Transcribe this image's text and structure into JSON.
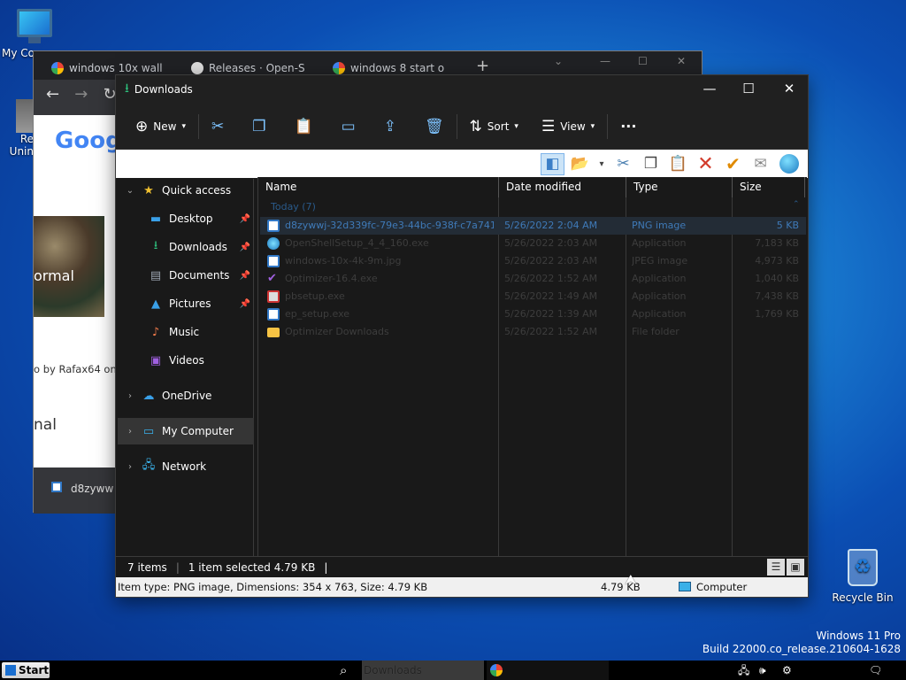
{
  "desktop": {
    "my_computer_label": "My Co",
    "recycle_bin_label": "Recycle Bin",
    "uninstall_label_1": "Re",
    "uninstall_label_2": "Unin",
    "watermark_line1": "Windows 11 Pro",
    "watermark_line2": "Build 22000.co_release.210604-1628"
  },
  "browser": {
    "tabs": [
      "windows 10x wall",
      "Releases · Open-S",
      "windows 8 start o"
    ],
    "new_tab": "+",
    "snippet_google": "Goog",
    "snippet_by": "o by Rafax64 on .",
    "snippet_ormal": "ormal",
    "snippet_nal": "nal",
    "download_item": "d8zyww"
  },
  "explorer": {
    "title": "Downloads",
    "commands": {
      "new": "New",
      "sort": "Sort",
      "view": "View",
      "more": "···"
    },
    "nav": [
      {
        "label": "Quick access",
        "icon": "star-icon"
      },
      {
        "label": "Desktop",
        "icon": "desktop-icon"
      },
      {
        "label": "Downloads",
        "icon": "download-icon"
      },
      {
        "label": "Documents",
        "icon": "document-icon"
      },
      {
        "label": "Pictures",
        "icon": "pictures-icon"
      },
      {
        "label": "Music",
        "icon": "music-icon"
      },
      {
        "label": "Videos",
        "icon": "videos-icon"
      },
      {
        "label": "OneDrive",
        "icon": "cloud-icon"
      },
      {
        "label": "My Computer",
        "icon": "computer-icon"
      },
      {
        "label": "Network",
        "icon": "network-icon"
      }
    ],
    "columns": [
      "Name",
      "Date modified",
      "Type",
      "Size"
    ],
    "group_label": "Today (7)",
    "files": [
      {
        "name": "d8zywwj-32d339fc-79e3-44bc-938f-c7a7413...",
        "date": "5/26/2022 2:04 AM",
        "type": "PNG image",
        "size": "5 KB",
        "icon": "image-icon"
      },
      {
        "name": "OpenShellSetup_4_4_160.exe",
        "date": "5/26/2022 2:03 AM",
        "type": "Application",
        "size": "7,183 KB",
        "icon": "setup-icon"
      },
      {
        "name": "windows-10x-4k-9m.jpg",
        "date": "5/26/2022 2:03 AM",
        "type": "JPEG image",
        "size": "4,973 KB",
        "icon": "image-icon"
      },
      {
        "name": "Optimizer-16.4.exe",
        "date": "5/26/2022 1:52 AM",
        "type": "Application",
        "size": "1,040 KB",
        "icon": "app-icon"
      },
      {
        "name": "pbsetup.exe",
        "date": "5/26/2022 1:49 AM",
        "type": "Application",
        "size": "7,438 KB",
        "icon": "app-icon"
      },
      {
        "name": "ep_setup.exe",
        "date": "5/26/2022 1:39 AM",
        "type": "Application",
        "size": "1,769 KB",
        "icon": "app-icon"
      },
      {
        "name": "Optimizer Downloads",
        "date": "5/26/2022 1:52 AM",
        "type": "File folder",
        "size": "",
        "icon": "folder-icon"
      }
    ],
    "status": {
      "items": "7 items",
      "selected": "1 item selected  4.79 KB",
      "divider": "|"
    },
    "infobar": {
      "details": "Item type: PNG image, Dimensions: 354 x 763, Size: 4.79 KB",
      "size": "4.79 KB",
      "location": "Computer"
    }
  },
  "taskbar": {
    "start": "Start",
    "downloads": "Downloads"
  }
}
